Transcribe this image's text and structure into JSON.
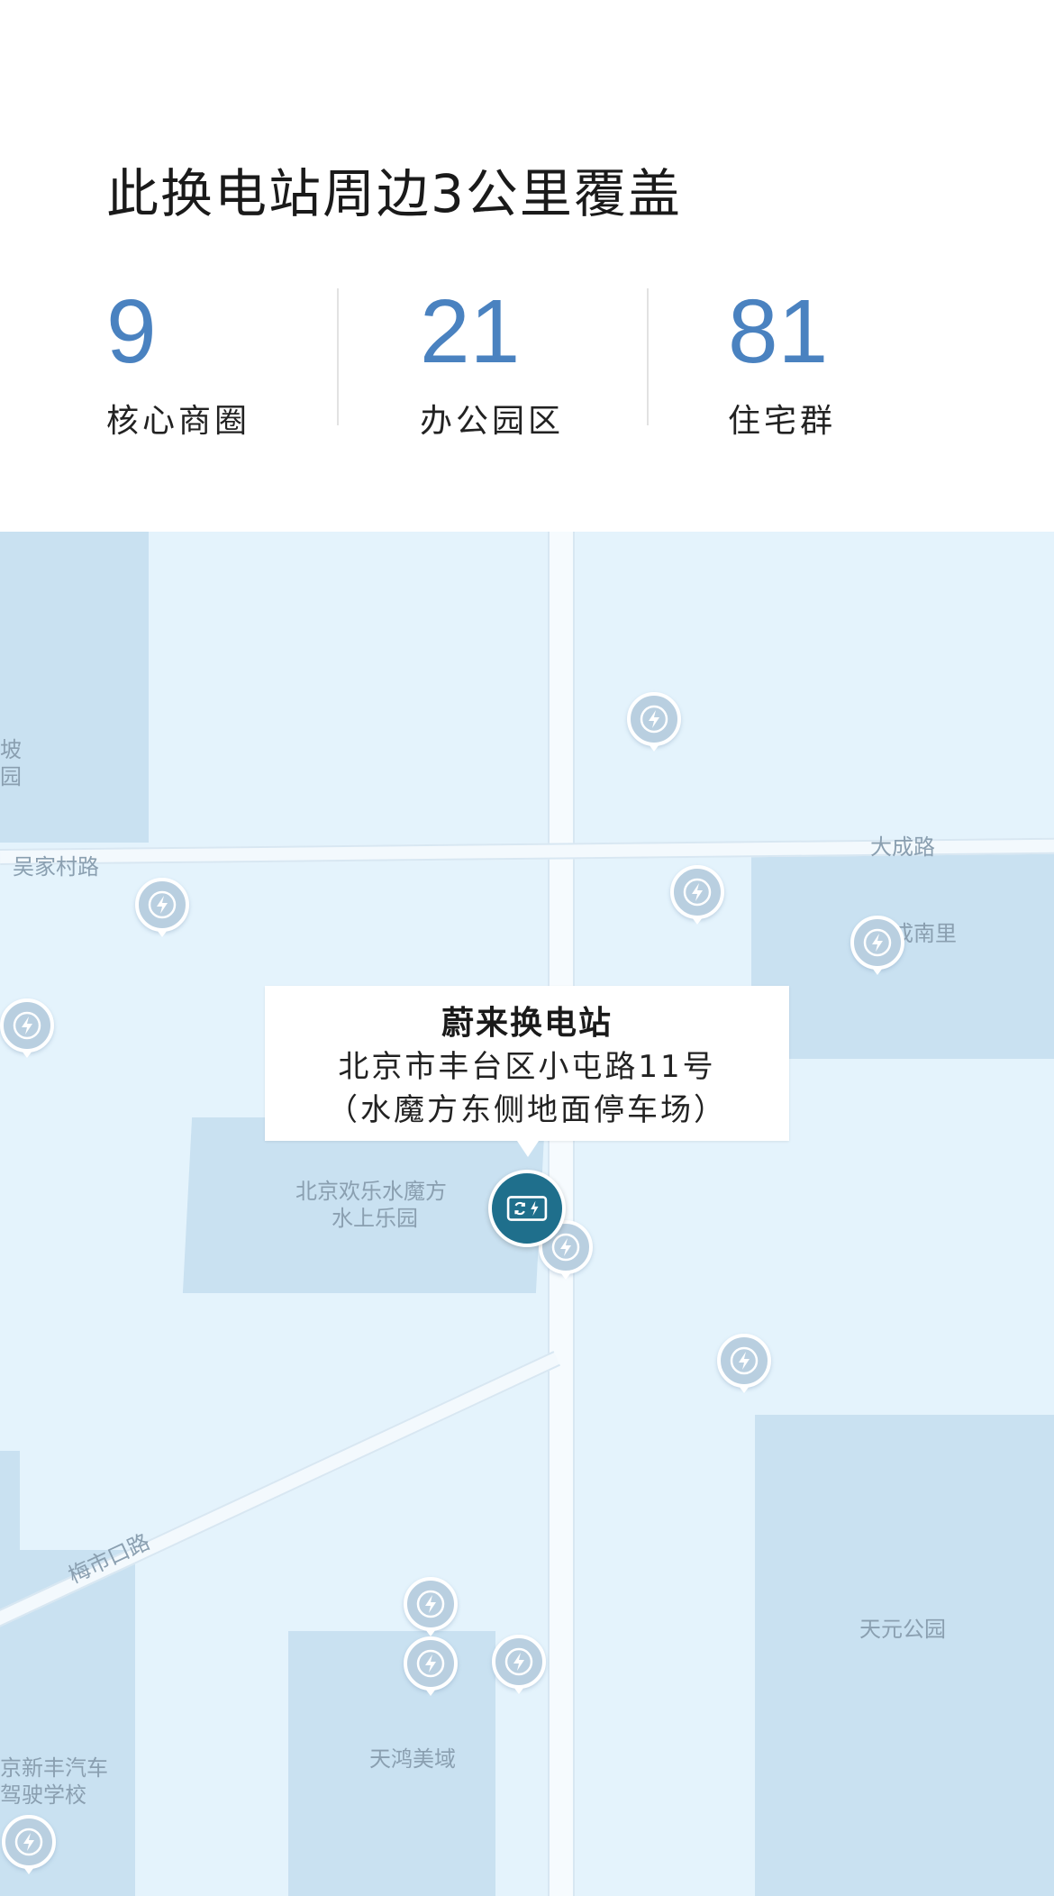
{
  "header": {
    "title": "此换电站周边3公里覆盖",
    "stats": [
      {
        "value": "9",
        "label": "核心商圈"
      },
      {
        "value": "21",
        "label": "办公园区"
      },
      {
        "value": "81",
        "label": "住宅群"
      }
    ]
  },
  "map": {
    "labels": {
      "wujiacun_road": "吴家村路",
      "dacheng_road": "大成路",
      "chengnanli": "成南里",
      "meishikou_road": "梅市口路",
      "park_fragment_1": "坡",
      "park_fragment_2": "园",
      "water_park_line1": "北京欢乐水魔方",
      "water_park_line2": "水上乐园",
      "tianyuan_park": "天元公园",
      "tianhong": "天鸿美域",
      "driving_school_line1": "京新丰汽车",
      "driving_school_line2": "驾驶学校"
    },
    "callout": {
      "name": "蔚来换电站",
      "address_line1": "北京市丰台区小屯路11号",
      "address_line2": "（水魔方东侧地面停车场）"
    },
    "pin_icon": "charging-bolt-icon",
    "station_icon": "battery-swap-icon",
    "colors": {
      "accent": "#4a82c0",
      "station": "#1f6f8c",
      "map_bg": "#e4f3fc",
      "pin": "#b9cfe0"
    }
  }
}
